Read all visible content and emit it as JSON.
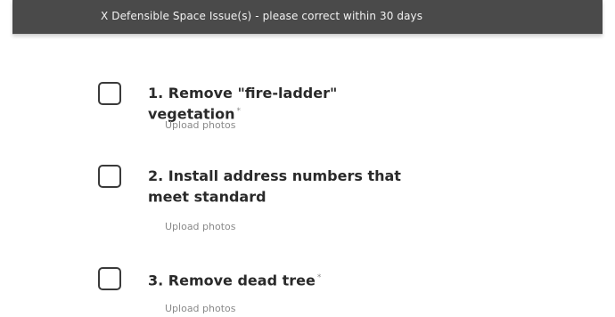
{
  "banner": {
    "text": "X Defensible Space Issue(s) - please correct within 30 days"
  },
  "items": [
    {
      "label": "1. Remove \"fire-ladder\" vegetation",
      "asterisk": "*",
      "upload_label": "Upload photos",
      "checked": false
    },
    {
      "label": "2. Install address numbers that meet standard",
      "asterisk": "",
      "upload_label": "Upload photos",
      "checked": false
    },
    {
      "label": "3. Remove dead tree",
      "asterisk": "*",
      "upload_label": "Upload photos",
      "checked": false
    }
  ]
}
